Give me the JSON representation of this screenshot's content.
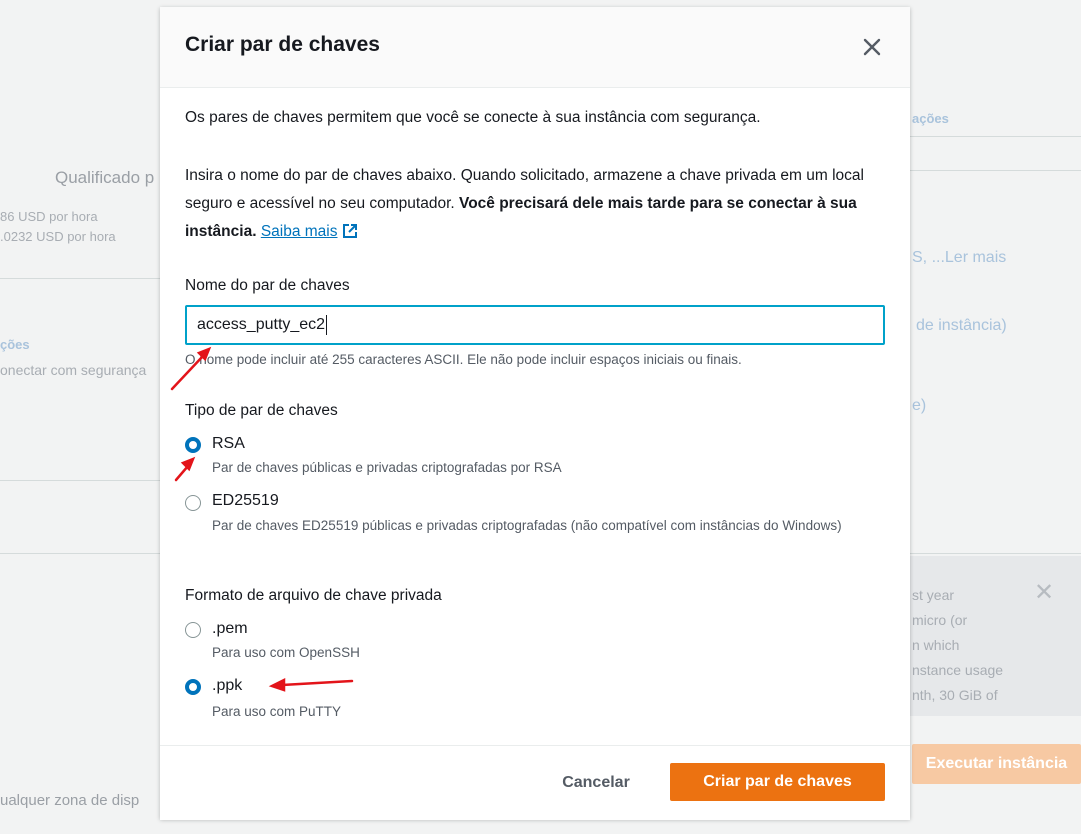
{
  "background": {
    "left_heading": "Qualificado p",
    "price_line_1": "86 USD por hora",
    "price_line_2": ".0232 USD por hora",
    "left_section_link": "ções",
    "left_section_text": "onectar com segurança",
    "bottom_text": "ualquer zona de disp",
    "right_link_1": "ações",
    "right_link_2": "S, ...Ler mais",
    "right_link_3": "de instância)",
    "right_link_4": "e)",
    "info_lines": [
      "st year",
      "micro (or",
      "n which",
      "nstance usage",
      "nth, 30 GiB of"
    ],
    "launch_button": "Executar instância",
    "close_glyph": "✕"
  },
  "modal": {
    "title": "Criar par de chaves",
    "intro": "Os pares de chaves permitem que você se conecte à sua instância com segurança.",
    "instruction_part1": "Insira o nome do par de chaves abaixo. Quando solicitado, armazene a chave privada em um local seguro e acessível no seu computador. ",
    "instruction_bold": "Você precisará dele mais tarde para se conectar à sua instância.",
    "learn_more": "Saiba mais",
    "name_label": "Nome do par de chaves",
    "name_value": "access_putty_ec2",
    "name_hint": "O nome pode incluir até 255 caracteres ASCII. Ele não pode incluir espaços iniciais ou finais.",
    "type_label": "Tipo de par de chaves",
    "type_options": [
      {
        "label": "RSA",
        "desc": "Par de chaves públicas e privadas criptografadas por RSA",
        "selected": true
      },
      {
        "label": "ED25519",
        "desc": "Par de chaves ED25519 públicas e privadas criptografadas (não compatível com instâncias do Windows)",
        "selected": false
      }
    ],
    "format_label": "Formato de arquivo de chave privada",
    "format_options": [
      {
        "label": ".pem",
        "desc": "Para uso com OpenSSH",
        "selected": false
      },
      {
        "label": ".ppk",
        "desc": "Para uso com PuTTY",
        "selected": true
      }
    ],
    "cancel": "Cancelar",
    "submit": "Criar par de chaves"
  },
  "colors": {
    "accent": "#0073bb",
    "primary_button": "#ec7211",
    "focus_border": "#00a1c9",
    "annotation_arrow": "#e3141a"
  }
}
